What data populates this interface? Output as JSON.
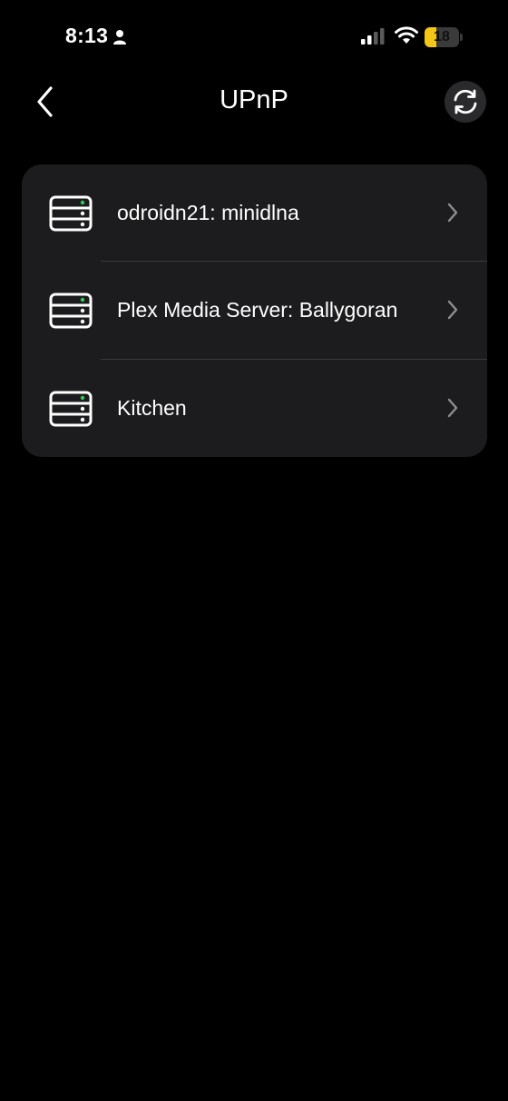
{
  "status_bar": {
    "time": "8:13",
    "battery_level": "18",
    "battery_fraction": 0.18,
    "battery_color": "#f5c518",
    "icons": [
      "person-icon",
      "cellular-signal-icon",
      "wifi-icon",
      "battery-icon"
    ]
  },
  "nav": {
    "title": "UPnP",
    "back_icon": "chevron-left-icon",
    "refresh_icon": "refresh-icon"
  },
  "devices": [
    {
      "label": "odroidn21: minidlna",
      "icon": "server-icon"
    },
    {
      "label": "Plex Media Server: Ballygoran",
      "icon": "server-icon"
    },
    {
      "label": "Kitchen",
      "icon": "server-icon"
    }
  ],
  "colors": {
    "background": "#000000",
    "card": "#1c1c1e",
    "divider": "#3a3a3c",
    "chevron": "#8e8e93",
    "indicator_green": "#34c759"
  }
}
